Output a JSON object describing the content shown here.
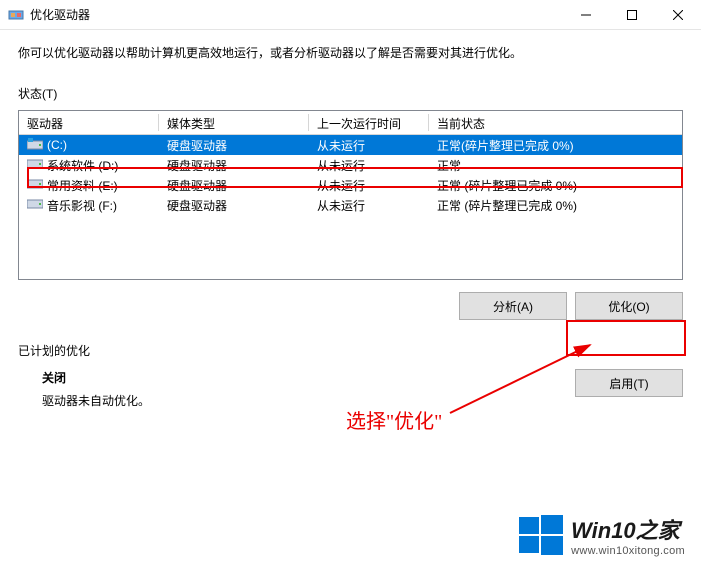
{
  "window": {
    "title": "优化驱动器",
    "min_tooltip": "最小化",
    "max_tooltip": "最大化",
    "close_tooltip": "关闭"
  },
  "description": "你可以优化驱动器以帮助计算机更高效地运行，或者分析驱动器以了解是否需要对其进行优化。",
  "status_label": "状态(T)",
  "columns": {
    "drive": "驱动器",
    "media": "媒体类型",
    "last": "上一次运行时间",
    "status": "当前状态"
  },
  "drives": [
    {
      "name": "(C:)",
      "media": "硬盘驱动器",
      "last": "从未运行",
      "status": "正常(碎片整理已完成 0%)",
      "selected": true,
      "icon": "os"
    },
    {
      "name": "系统软件 (D:)",
      "media": "硬盘驱动器",
      "last": "从未运行",
      "status": "正常",
      "selected": false,
      "icon": "hdd"
    },
    {
      "name": "常用资料 (E:)",
      "media": "硬盘驱动器",
      "last": "从未运行",
      "status": "正常 (碎片整理已完成 0%)",
      "selected": false,
      "icon": "hdd"
    },
    {
      "name": "音乐影视 (F:)",
      "media": "硬盘驱动器",
      "last": "从未运行",
      "status": "正常 (碎片整理已完成 0%)",
      "selected": false,
      "icon": "hdd"
    }
  ],
  "buttons": {
    "analyze": "分析(A)",
    "optimize": "优化(O)",
    "enable": "启用(T)"
  },
  "schedule": {
    "label": "已计划的优化",
    "line1": "关闭",
    "line2": "驱动器未自动优化。"
  },
  "annotation": {
    "text": "选择\"优化\""
  },
  "watermark": {
    "brand": "Win10之家",
    "url": "www.win10xitong.com"
  },
  "colors": {
    "selection": "#0078d7",
    "red": "#ea0000"
  }
}
